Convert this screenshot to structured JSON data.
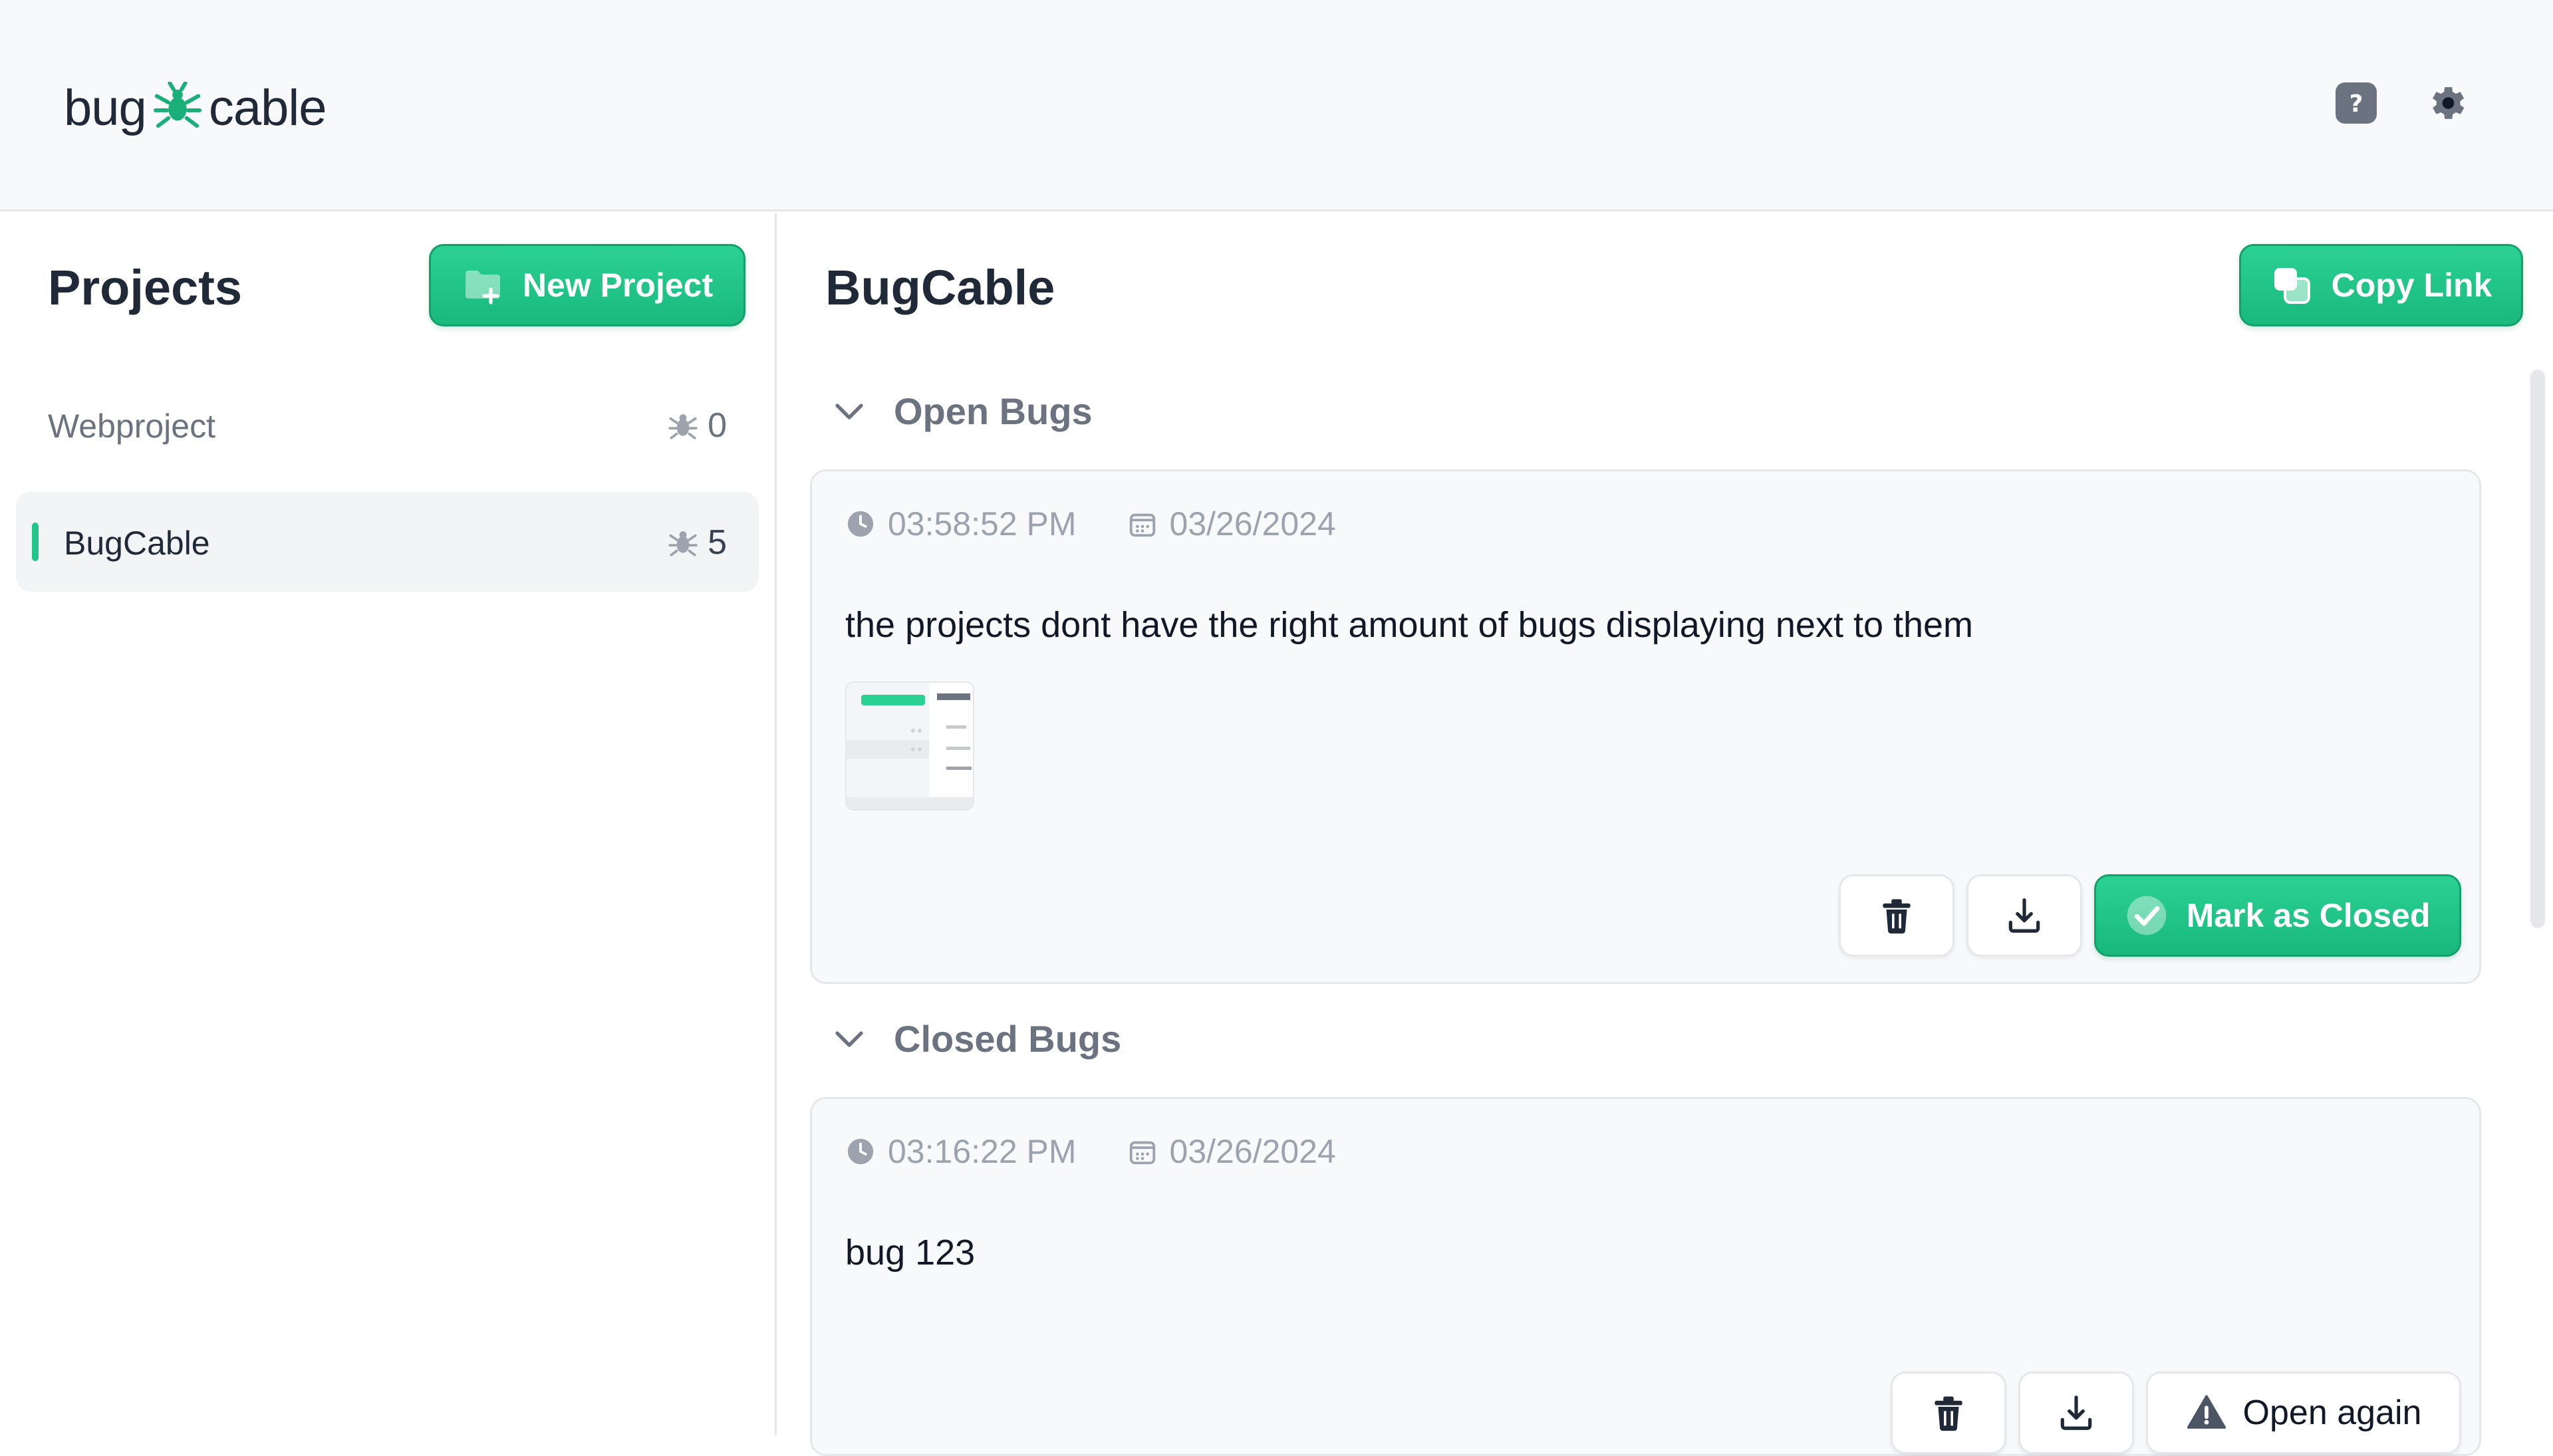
{
  "header": {
    "logo_left": "bug",
    "logo_right": "cable",
    "help_icon": "question-icon",
    "settings_icon": "gear-icon"
  },
  "sidebar": {
    "title": "Projects",
    "new_project_label": "New Project",
    "projects": [
      {
        "name": "Webproject",
        "bug_count": "0",
        "active": false
      },
      {
        "name": "BugCable",
        "bug_count": "5",
        "active": true
      }
    ]
  },
  "main": {
    "title": "BugCable",
    "copy_link_label": "Copy Link",
    "open_section": {
      "label": "Open Bugs",
      "bugs": [
        {
          "time": "03:58:52 PM",
          "date": "03/26/2024",
          "description": "the projects dont have the right amount of bugs displaying next to them",
          "has_screenshot": true,
          "action_label": "Mark as Closed"
        }
      ]
    },
    "closed_section": {
      "label": "Closed Bugs",
      "bugs": [
        {
          "time": "03:16:22 PM",
          "date": "03/26/2024",
          "description": "bug 123",
          "action_label": "Open again"
        }
      ]
    }
  },
  "colors": {
    "accent": "#1fc285",
    "accent_dark": "#14a06b",
    "muted_text": "#6b7280",
    "card_bg": "#f8f9fb"
  }
}
